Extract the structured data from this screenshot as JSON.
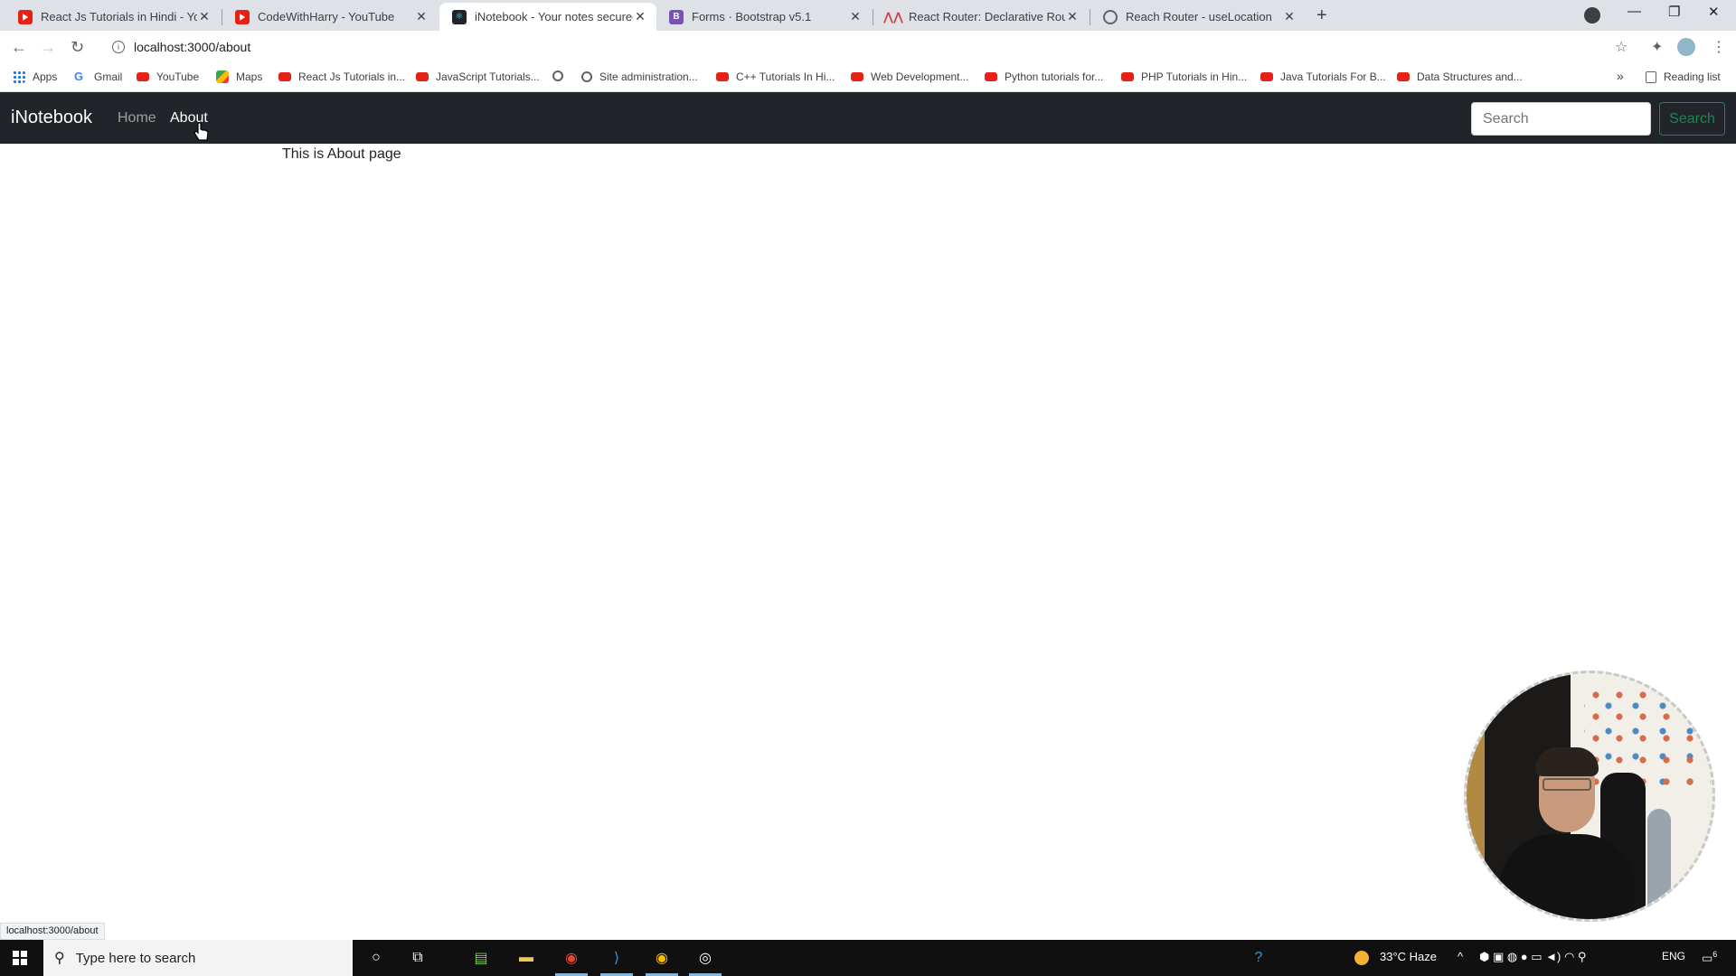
{
  "browser": {
    "tabs": [
      {
        "title": "React Js Tutorials in Hindi - YouT",
        "icon": "youtube-icon"
      },
      {
        "title": "CodeWithHarry - YouTube",
        "icon": "youtube-icon"
      },
      {
        "title": "iNotebook - Your notes secured",
        "icon": "react-icon",
        "active": true
      },
      {
        "title": "Forms · Bootstrap v5.1",
        "icon": "bootstrap-icon"
      },
      {
        "title": "React Router: Declarative Routing",
        "icon": "react-router-icon"
      },
      {
        "title": "Reach Router - useLocation",
        "icon": "globe-icon"
      }
    ],
    "url": "localhost:3000/about",
    "bookmarks": [
      {
        "label": "Apps",
        "icon": "apps-grid-icon"
      },
      {
        "label": "Gmail",
        "icon": "google-icon"
      },
      {
        "label": "YouTube",
        "icon": "youtube-icon"
      },
      {
        "label": "Maps",
        "icon": "maps-icon"
      },
      {
        "label": "React Js Tutorials in...",
        "icon": "youtube-icon"
      },
      {
        "label": "JavaScript Tutorials...",
        "icon": "youtube-icon"
      },
      {
        "label": "",
        "icon": "globe-icon"
      },
      {
        "label": "Site administration...",
        "icon": "globe-icon"
      },
      {
        "label": "C++ Tutorials In Hi...",
        "icon": "youtube-icon"
      },
      {
        "label": "Web Development...",
        "icon": "youtube-icon"
      },
      {
        "label": "Python tutorials for...",
        "icon": "youtube-icon"
      },
      {
        "label": "PHP Tutorials in Hin...",
        "icon": "youtube-icon"
      },
      {
        "label": "Java Tutorials For B...",
        "icon": "youtube-icon"
      },
      {
        "label": "Data Structures and...",
        "icon": "youtube-icon"
      }
    ],
    "more_bookmarks": "»",
    "reading_list": "Reading list",
    "status_url": "localhost:3000/about"
  },
  "app": {
    "brand": "iNotebook",
    "nav": [
      {
        "label": "Home",
        "active": false
      },
      {
        "label": "About",
        "active": true
      }
    ],
    "search_placeholder": "Search",
    "search_button": "Search",
    "page_text": "This is About page"
  },
  "taskbar": {
    "search_placeholder": "Type here to search",
    "weather": "33°C  Haze",
    "language": "ENG",
    "notification_count": "6"
  }
}
